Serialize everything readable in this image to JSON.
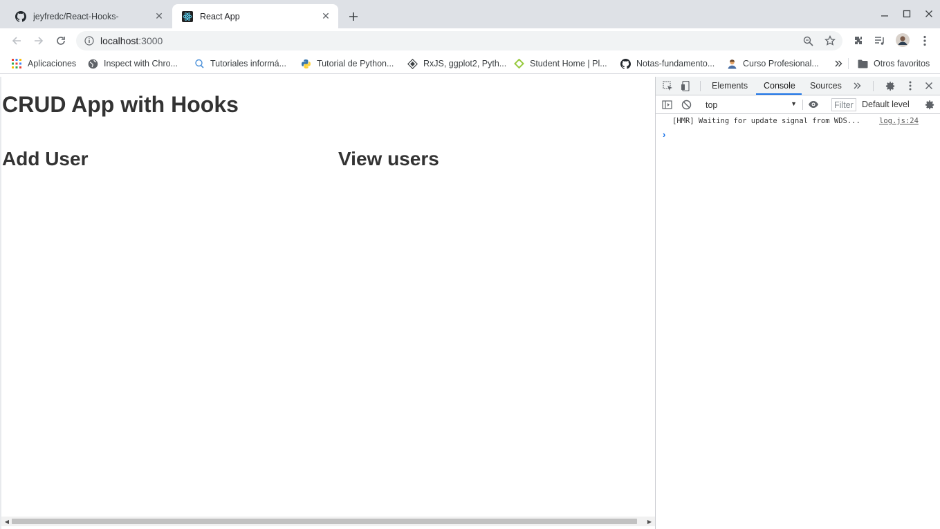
{
  "tabs": [
    {
      "title": "jeyfredc/React-Hooks-",
      "favicon": "github-icon"
    },
    {
      "title": "React App",
      "favicon": "react-icon"
    }
  ],
  "address_bar": {
    "host": "localhost",
    "port": ":3000"
  },
  "bookmarks": [
    {
      "label": "Aplicaciones",
      "icon": "apps-grid-icon"
    },
    {
      "label": "Inspect with Chro...",
      "icon": "globe-icon"
    },
    {
      "label": "Tutoriales informá...",
      "icon": "search-bulb-icon"
    },
    {
      "label": "Tutorial de Python...",
      "icon": "python-icon"
    },
    {
      "label": "RxJS, ggplot2, Pyth...",
      "icon": "diamond-icon"
    },
    {
      "label": "Student Home | Pl...",
      "icon": "platzi-icon"
    },
    {
      "label": "Notas-fundamento...",
      "icon": "github-icon"
    },
    {
      "label": "Curso Profesional...",
      "icon": "person-icon"
    }
  ],
  "other_bookmarks": "Otros favoritos",
  "page": {
    "title": "CRUD App with Hooks",
    "add_user_heading": "Add User",
    "view_users_heading": "View users"
  },
  "devtools": {
    "tabs": [
      "Elements",
      "Console",
      "Sources"
    ],
    "active_tab": "Console",
    "context": "top",
    "filter_placeholder": "Filter",
    "level": "Default level",
    "console_message": "[HMR] Waiting for update signal from WDS...",
    "console_source": "log.js:24",
    "prompt": "›"
  },
  "colors": {
    "accent": "#1a73e8",
    "tabstrip": "#dee1e6",
    "heading": "#333333"
  }
}
